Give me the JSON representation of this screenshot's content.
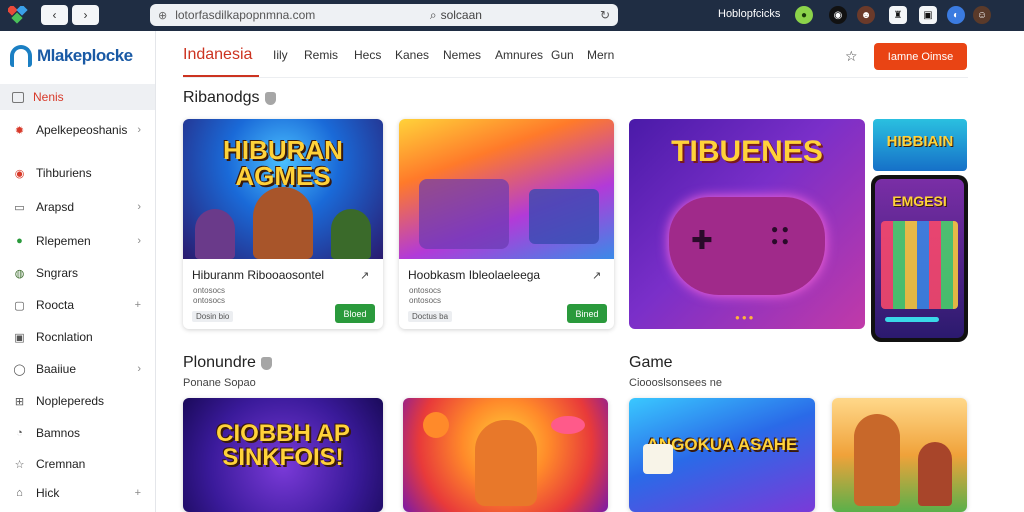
{
  "browser": {
    "url": "lotorfasdilkapopnmna.com",
    "search_text": "solcaan",
    "site_title": "Hoblopfcicks"
  },
  "sidebar": {
    "brand": "Mlakeplocke",
    "items": [
      {
        "label": "Nenis",
        "icon": "home-icon",
        "active": true,
        "trail": ""
      },
      {
        "label": "Apelkepeoshanis",
        "icon": "gear-icon",
        "active": false,
        "trail": "›"
      },
      {
        "label": "Tihburiens",
        "icon": "target-icon",
        "active": false,
        "trail": ""
      },
      {
        "label": "Arapsd",
        "icon": "monitor-icon",
        "active": false,
        "trail": "›"
      },
      {
        "label": "Rlepemen",
        "icon": "circle-icon",
        "active": false,
        "trail": "›"
      },
      {
        "label": "Sngrars",
        "icon": "globe-icon",
        "active": false,
        "trail": ""
      },
      {
        "label": "Roocta",
        "icon": "box-icon",
        "active": false,
        "trail": "+"
      },
      {
        "label": "Rocnlation",
        "icon": "image-icon",
        "active": false,
        "trail": ""
      },
      {
        "label": "Baaiiue",
        "icon": "pin-icon",
        "active": false,
        "trail": "›"
      },
      {
        "label": "Noplepereds",
        "icon": "book-icon",
        "active": false,
        "trail": ""
      },
      {
        "label": "Bamnos",
        "icon": "clock-icon",
        "active": false,
        "trail": ""
      },
      {
        "label": "Cremnan",
        "icon": "star-icon",
        "active": false,
        "trail": ""
      },
      {
        "label": "Hick",
        "icon": "bag-icon",
        "active": false,
        "trail": "+"
      }
    ]
  },
  "tabs": [
    "Indanesia",
    "Iily",
    "Remis",
    "Hecs",
    "Kanes",
    "Nemes",
    "Amnures",
    "Gun",
    "Mern"
  ],
  "cta_label": "Iamne Oimse",
  "sections": {
    "featured_title": "Ribanodgs",
    "second_title": "Plonundre",
    "second_sub": "Ponane Sopao",
    "game_title": "Game",
    "game_sub": "Cioooslsonsees ne"
  },
  "cards": [
    {
      "art_text": "HIBURAN AGMES",
      "title": "Hiburanm Ribooaosontel",
      "meta": "ontosocs",
      "tag": "Dosin bio",
      "button": "Bloed"
    },
    {
      "art_text": "",
      "title": "Hoobkasm Ibleolaeleega",
      "meta": "ontosocs",
      "tag": "Doctus ba",
      "button": "Bined"
    }
  ],
  "banners": {
    "big": "TIBUENES",
    "small": "HIBBIAIN",
    "phone": "EMGESI"
  },
  "bottom_cards": [
    {
      "art_text": "CIOBBH AP SINKFOIS!"
    },
    {
      "art_text": ""
    },
    {
      "art_text": "ANGOKUA ASAHE"
    },
    {
      "art_text": ""
    }
  ],
  "colors": {
    "accent": "#cc3320",
    "cta": "#e94414",
    "green_button": "#2a9a3c",
    "chrome": "#1f2d43"
  }
}
